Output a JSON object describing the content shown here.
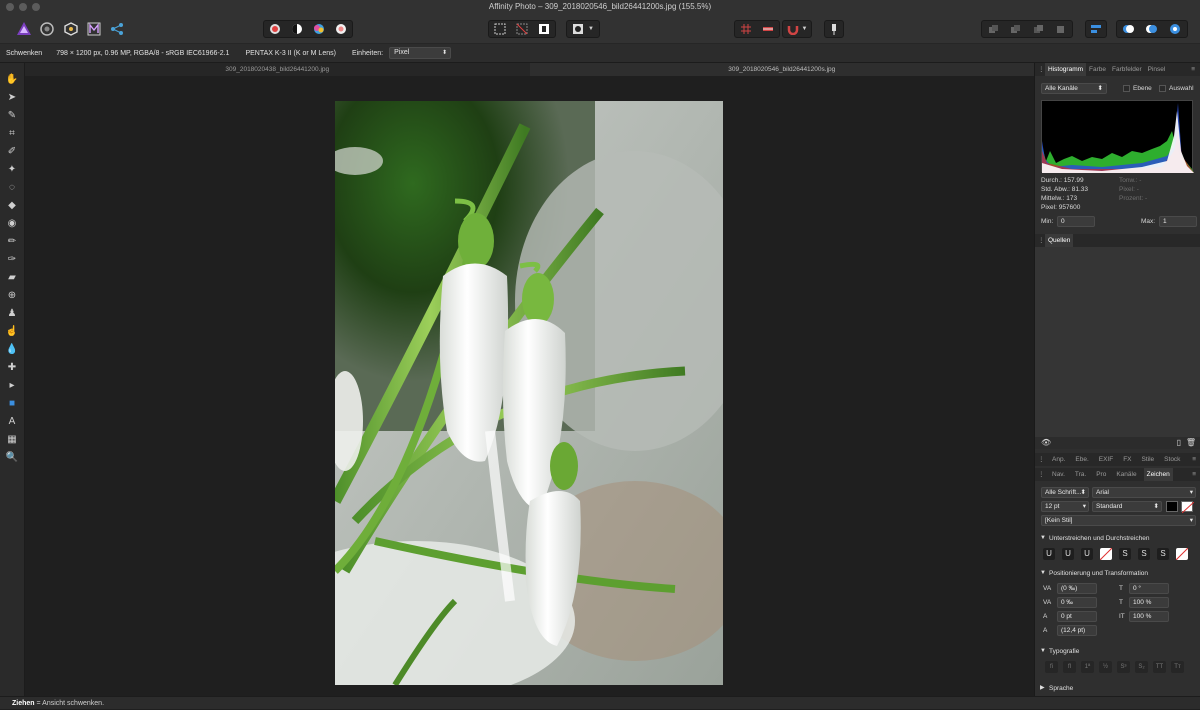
{
  "window": {
    "title": "Affinity Photo – 309_2018020546_bild26441200s.jpg (155.5%)"
  },
  "context_bar": {
    "tool_name": "Schwenken",
    "image_info": "798 × 1200 px, 0.96 MP, RGBA/8 - sRGB IEC61966-2.1",
    "camera": "PENTAX K-3 II (K or M Lens)",
    "units_label": "Einheiten:",
    "units_value": "Pixel"
  },
  "doc_tabs": [
    "309_2018020438_bild26441200.jpg",
    "309_2018020546_bild26441200s.jpg"
  ],
  "tools_icons": [
    "hand-tool-icon",
    "move-tool-icon",
    "color-picker-icon",
    "crop-tool-icon",
    "selection-brush-icon",
    "flood-select-icon",
    "lasso-icon",
    "fill-tool-icon",
    "gradient-tool-icon",
    "paint-brush-icon",
    "color-replace-icon",
    "eraser-icon",
    "clone-tool-icon",
    "dodge-tool-icon",
    "smudge-tool-icon",
    "blur-tool-icon",
    "healing-icon",
    "node-tool-icon",
    "shape-tool-icon",
    "text-tool-icon",
    "mesh-warp-icon",
    "zoom-tool-icon"
  ],
  "histogram_panel": {
    "tabs": [
      "Histogramm",
      "Farbe",
      "Farbfelder",
      "Pinsel"
    ],
    "channel": "Alle Kanäle",
    "layer_label": "Ebene",
    "selection_label": "Auswahl",
    "stats_left": [
      "Durch.: 157.99",
      "Std. Abw.: 81.33",
      "Mittelw.: 173",
      "Pixel: 957600"
    ],
    "stats_right": [
      "Tonw.: -",
      "Pixel: -",
      "Prozent: -"
    ],
    "min_label": "Min:",
    "min_value": "0",
    "max_label": "Max:",
    "max_value": "1"
  },
  "sources_panel": {
    "title": "Quellen"
  },
  "panel_tabs_row1": [
    "Anp.",
    "Ebe.",
    "EXIF",
    "FX",
    "Stile",
    "Stock"
  ],
  "panel_tabs_row2": [
    "Nav.",
    "Tra.",
    "Pro",
    "Kanäle",
    "Zeichen"
  ],
  "character_panel": {
    "font_collection": "Alle Schrift...",
    "font_family": "Arial",
    "font_size": "12 pt",
    "font_style": "Standard",
    "paragraph_style": "[Kein Stil]",
    "section_underline": "Unterstreichen und Durchstreichen",
    "underline_buttons": [
      "U",
      "U",
      "U",
      "",
      "S",
      "S",
      "S",
      ""
    ],
    "section_position": "Positionierung und Transformation",
    "tracking": "(0 ‰)",
    "kerning": "0 ‰",
    "baseline": "0 pt",
    "leading": "(12,4 pt)",
    "shear": "0 °",
    "horizontal_scale": "100 %",
    "vertical_scale": "100 %",
    "section_typography": "Typografie",
    "typography_buttons": [
      "fi",
      "ﬂ",
      "1ª",
      "½",
      "Sˢ",
      "S₂",
      "TT",
      "Tт"
    ],
    "section_language": "Sprache"
  },
  "status_bar": {
    "action": "Ziehen",
    "hint": " = Ansicht schwenken."
  },
  "colors": {
    "accent": "#1f6fc9",
    "panel_bg": "#2f2f2f",
    "canvas_bg": "#1f1f1f"
  }
}
